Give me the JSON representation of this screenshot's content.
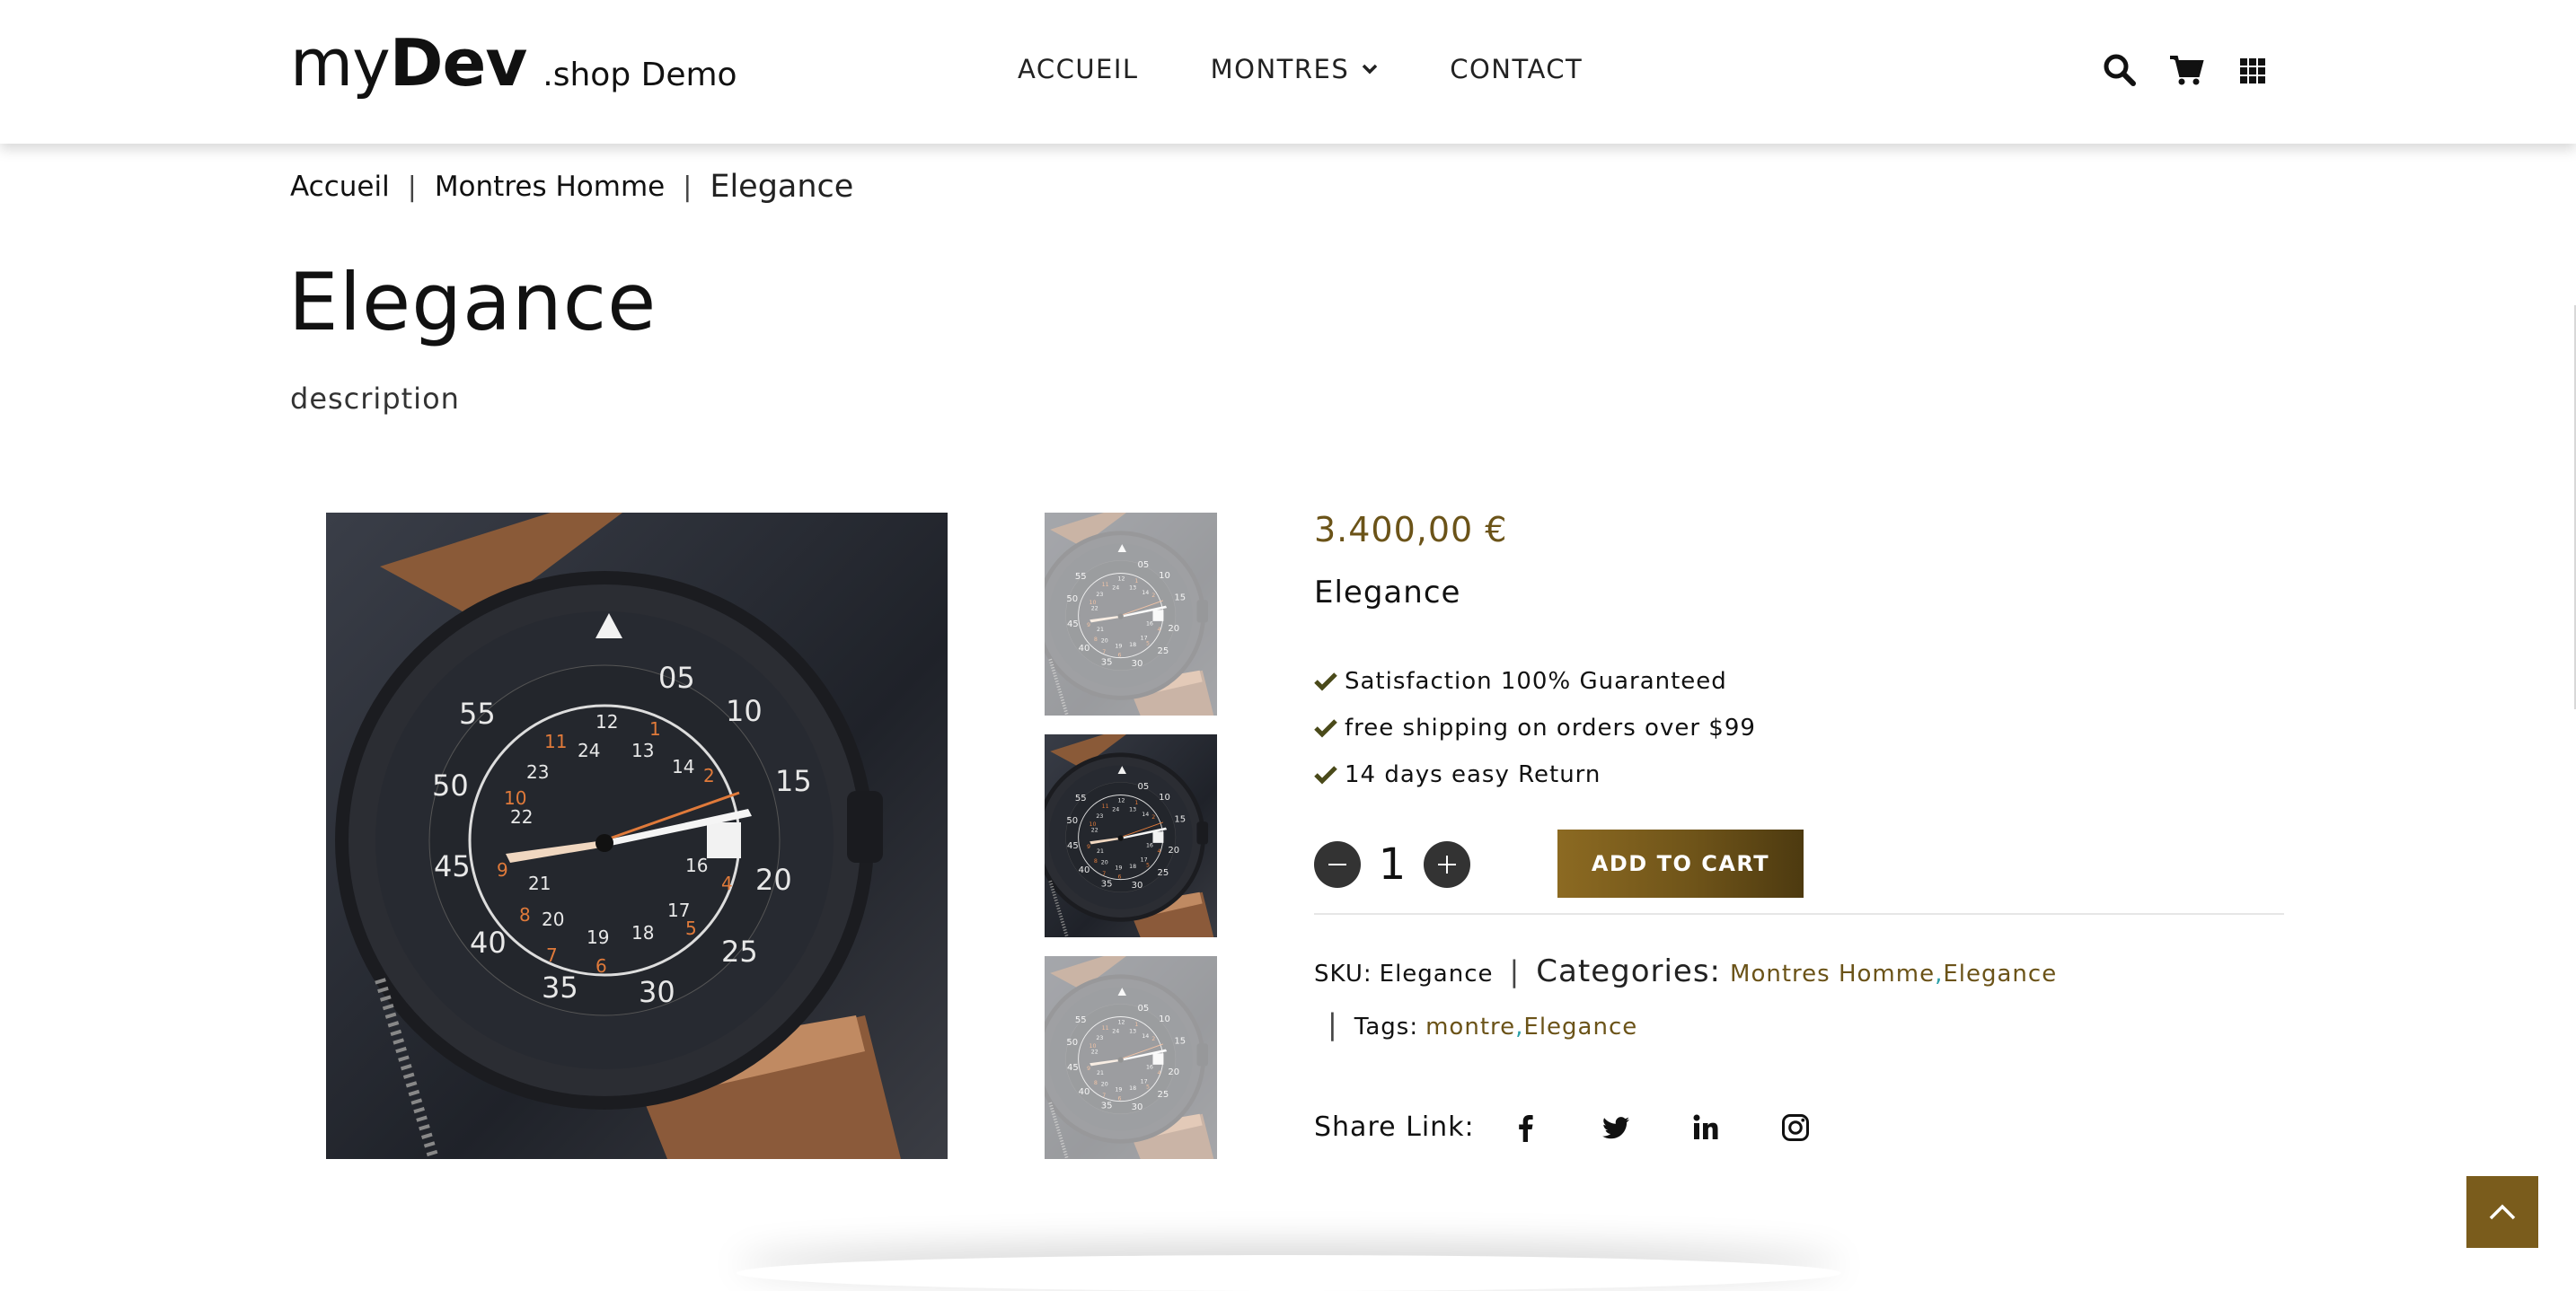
{
  "header": {
    "logo": {
      "my": "my",
      "dev": "Dev",
      "shop": ".shop Demo"
    },
    "nav": [
      {
        "label": "ACCUEIL"
      },
      {
        "label": "MONTRES"
      },
      {
        "label": "CONTACT"
      }
    ],
    "icons": [
      "search-icon",
      "cart-icon",
      "grid-menu-icon"
    ]
  },
  "breadcrumb": {
    "items": [
      "Accueil",
      "Montres Homme"
    ],
    "separator": "|",
    "current": "Elegance"
  },
  "page": {
    "title": "Elegance",
    "description": "description"
  },
  "product": {
    "price": "3.400,00 €",
    "name": "Elegance",
    "features": [
      "Satisfaction 100% Guaranteed",
      "free shipping on orders over $99",
      "14 days easy Return"
    ],
    "quantity": "1",
    "add_to_cart": "ADD TO CART",
    "sku_label": "SKU:",
    "sku": "Elegance",
    "categories_label": "Categories:",
    "categories": [
      "Montres Homme",
      "Elegance"
    ],
    "tags_label": "Tags:",
    "tags": [
      "montre",
      "Elegance"
    ],
    "share_label": "Share Link:",
    "share_icons": [
      "facebook-icon",
      "twitter-icon",
      "linkedin-icon",
      "instagram-icon"
    ]
  },
  "colors": {
    "accent": "#6b5318",
    "button": "#7a5c1c",
    "dark": "#333333"
  }
}
